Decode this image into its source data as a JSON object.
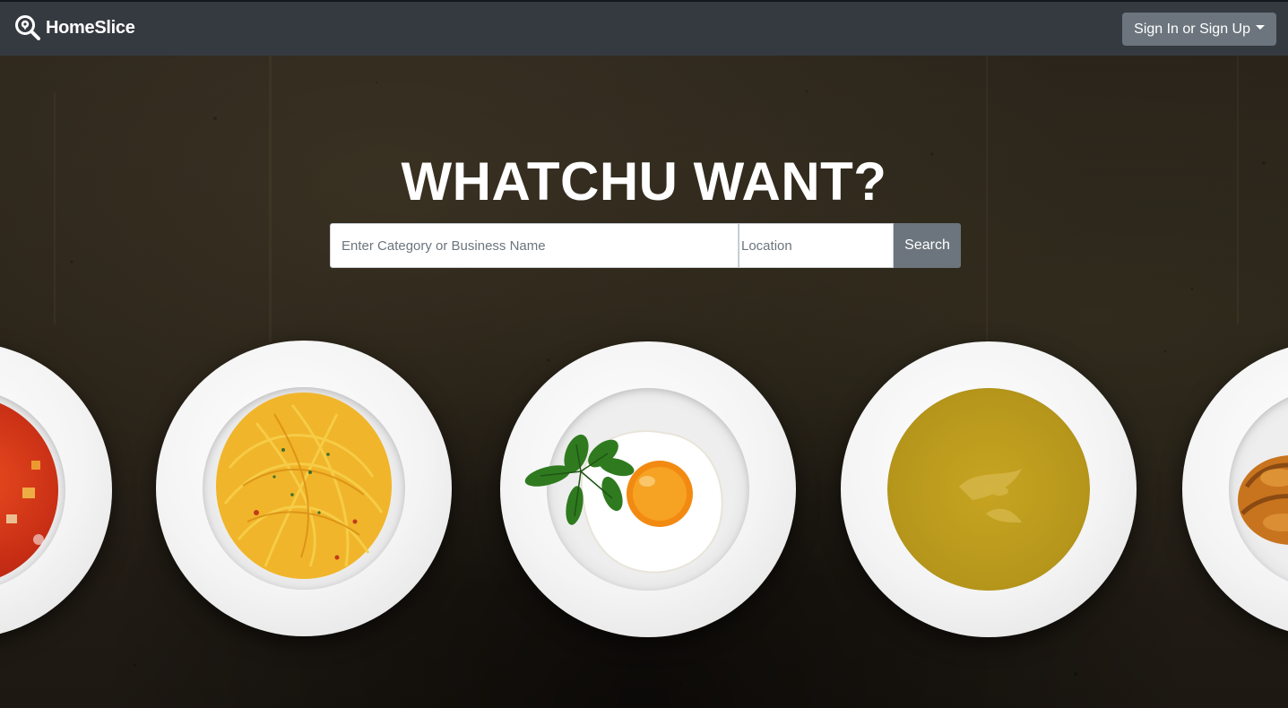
{
  "navbar": {
    "brand_name": "HomeSlice",
    "brand_icon": "search-location-icon",
    "signin_label": "Sign In or Sign Up"
  },
  "hero": {
    "title": "WHATCHU WANT?",
    "search": {
      "category_placeholder": "Enter Category or Business Name",
      "category_value": "",
      "location_placeholder": "Location",
      "location_value": "",
      "button_label": "Search"
    }
  },
  "plates": [
    {
      "name": "tomato-soup"
    },
    {
      "name": "spaghetti"
    },
    {
      "name": "fried-egg"
    },
    {
      "name": "yellow-soup"
    },
    {
      "name": "croissant"
    }
  ],
  "colors": {
    "navbar": "#343a40",
    "button": "#6c757d",
    "hero_background": "#262017"
  }
}
